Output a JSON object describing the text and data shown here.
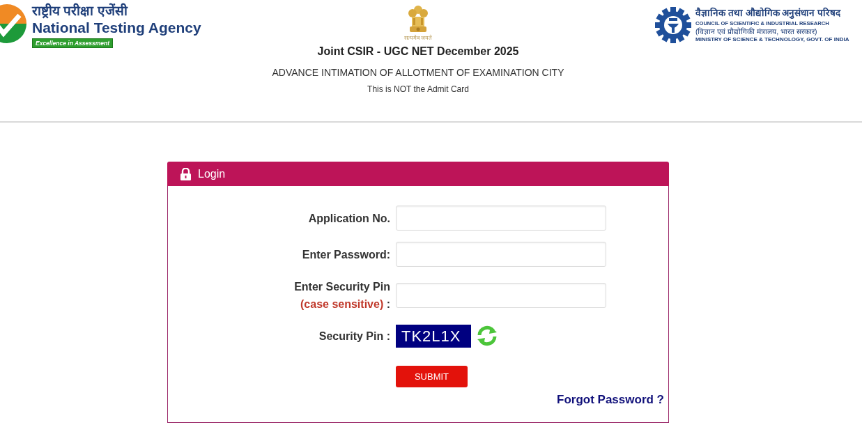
{
  "header": {
    "left_logo": {
      "hindi": "राष्ट्रीय परीक्षा एजेंसी",
      "english": "National Testing Agency",
      "tagline": "Excellence in Assessment"
    },
    "emblem": {
      "motto": "सत्यमेव जयते"
    },
    "right_logo": {
      "hindi": "वैज्ञानिक तथा औद्योगिक अनुसंधान परिषद",
      "english": "COUNCIL OF SCIENTIFIC & INDUSTRIAL RESEARCH",
      "ministry_hindi": "(विज्ञान एवं प्रौद्योगिकी मंत्रालय, भारत सरकार)",
      "ministry_english": "MINISTRY OF SCIENCE & TECHNOLOGY, GOVT. OF INDIA"
    },
    "title": "Joint CSIR - UGC NET December 2025",
    "subtitle": "ADVANCE INTIMATION OF ALLOTMENT OF EXAMINATION CITY",
    "note": "This is NOT the Admit Card"
  },
  "login": {
    "title": "Login",
    "fields": [
      {
        "label": "Application No."
      },
      {
        "label": "Enter Password:"
      },
      {
        "label": "Enter Security Pin",
        "hint": "(case sensitive)",
        "suffix": ":"
      }
    ],
    "security_pin": {
      "label": "Security Pin :",
      "code": "TK2L1X"
    },
    "submit": "SUBMIT",
    "forgot_password": "Forgot Password ?"
  }
}
